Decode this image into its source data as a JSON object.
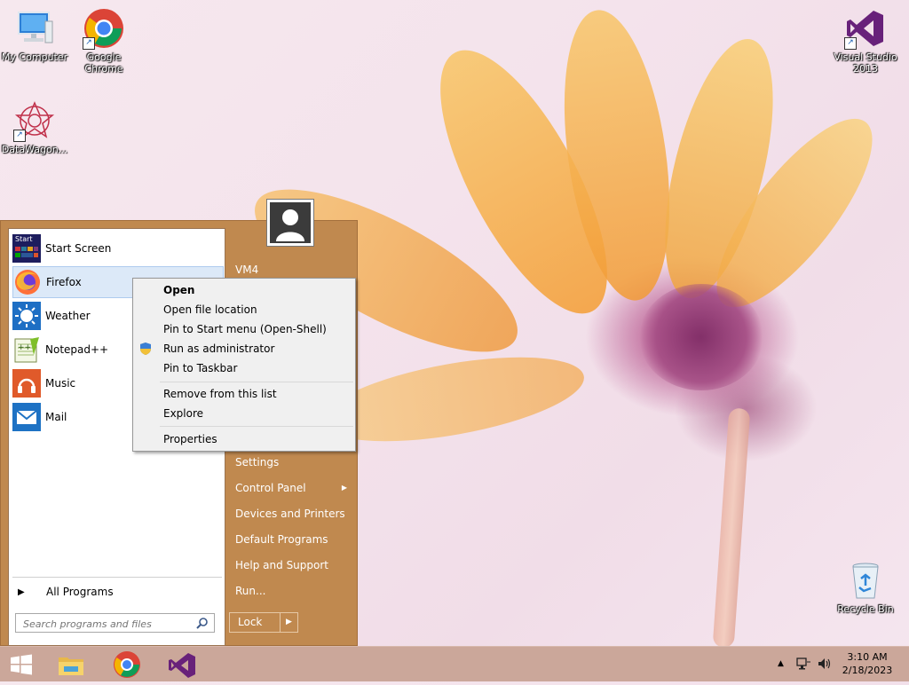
{
  "desktop": {
    "icons": [
      {
        "label": "My Computer"
      },
      {
        "label": "Google Chrome"
      },
      {
        "label": "DataWagon..."
      },
      {
        "label": "Visual Studio 2013"
      },
      {
        "label": "Recycle Bin"
      }
    ]
  },
  "start_menu": {
    "programs": [
      {
        "label": "Start Screen",
        "icon": "start-screen-icon"
      },
      {
        "label": "Firefox",
        "icon": "firefox-icon"
      },
      {
        "label": "Weather",
        "icon": "weather-icon"
      },
      {
        "label": "Notepad++",
        "icon": "notepad-plus-plus-icon"
      },
      {
        "label": "Music",
        "icon": "music-icon"
      },
      {
        "label": "Mail",
        "icon": "mail-icon"
      }
    ],
    "start_screen_badge": "Start",
    "all_programs": "All Programs",
    "search_placeholder": "Search programs and files",
    "right_items": {
      "user": "VM4",
      "settings": "Settings",
      "control_panel": "Control Panel",
      "devices": "Devices and Printers",
      "default_programs": "Default Programs",
      "help": "Help and Support",
      "run": "Run..."
    },
    "lock_label": "Lock"
  },
  "context_menu": {
    "open": "Open",
    "open_file_location": "Open file location",
    "pin_start": "Pin to Start menu (Open-Shell)",
    "run_admin": "Run as administrator",
    "pin_taskbar": "Pin to Taskbar",
    "remove": "Remove from this list",
    "explore": "Explore",
    "properties": "Properties"
  },
  "taskbar": {
    "time": "3:10 AM",
    "date": "2/18/2023"
  },
  "colors": {
    "start_menu_bg": "#c0894f",
    "taskbar_bg": "#cba79a",
    "selection": "#dce9f8"
  }
}
